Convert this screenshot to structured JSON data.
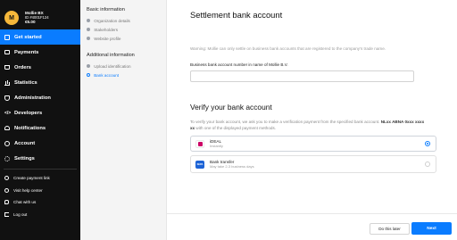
{
  "organization": {
    "avatar_letter": "M",
    "name": "Mollie BX",
    "id": "ID #4001F124",
    "balance": "€5.00"
  },
  "sidebar": {
    "items": [
      {
        "label": "Get started",
        "icon": "home-icon"
      },
      {
        "label": "Payments",
        "icon": "card-icon"
      },
      {
        "label": "Orders",
        "icon": "bag-icon"
      },
      {
        "label": "Statistics",
        "icon": "chart-icon"
      },
      {
        "label": "Administration",
        "icon": "admin-icon"
      },
      {
        "label": "Developers",
        "icon": "code-icon"
      },
      {
        "label": "Notifications",
        "icon": "bell-icon"
      },
      {
        "label": "Account",
        "icon": "user-icon"
      },
      {
        "label": "Settings",
        "icon": "gear-icon"
      }
    ],
    "utility": [
      {
        "label": "Create payment link",
        "icon": "plus-circle-icon"
      },
      {
        "label": "Visit help center",
        "icon": "help-icon"
      },
      {
        "label": "Chat with us",
        "icon": "chat-icon"
      },
      {
        "label": "Log out",
        "icon": "logout-icon"
      }
    ],
    "active_color": "#0a7cff",
    "background": "#111111"
  },
  "steps": {
    "group1_title": "Basic information",
    "group1": [
      "Organization details",
      "Stakeholders",
      "Website profile"
    ],
    "group2_title": "Additional information",
    "group2": [
      "Upload identification",
      "Bank account"
    ]
  },
  "main": {
    "title": "Settlement bank account",
    "warning": "Warning: Mollie can only settle on business bank accounts that are registered to the company's trade name.",
    "field_label": "Business bank account number in name of Mollie B.V.",
    "field_value": "",
    "verify_title": "Verify your bank account",
    "verify_text_1": "To verify your bank account, we ask you to make a verification payment from the specified bank account.",
    "verify_account": "NLxx ABNA 0xxx xxxx xx",
    "verify_text_2": "with one of the displayed payment methods.",
    "methods": [
      {
        "name": "iDEAL",
        "sub": "Instantly",
        "logo": "ideal-logo",
        "selected": true
      },
      {
        "name": "Bank transfer",
        "sub": "May take 2-3 business days",
        "logo": "bank-transfer-logo",
        "logo_text": "SEPA",
        "selected": false
      }
    ]
  },
  "footer": {
    "later_label": "Do this later",
    "next_label": "Next"
  }
}
